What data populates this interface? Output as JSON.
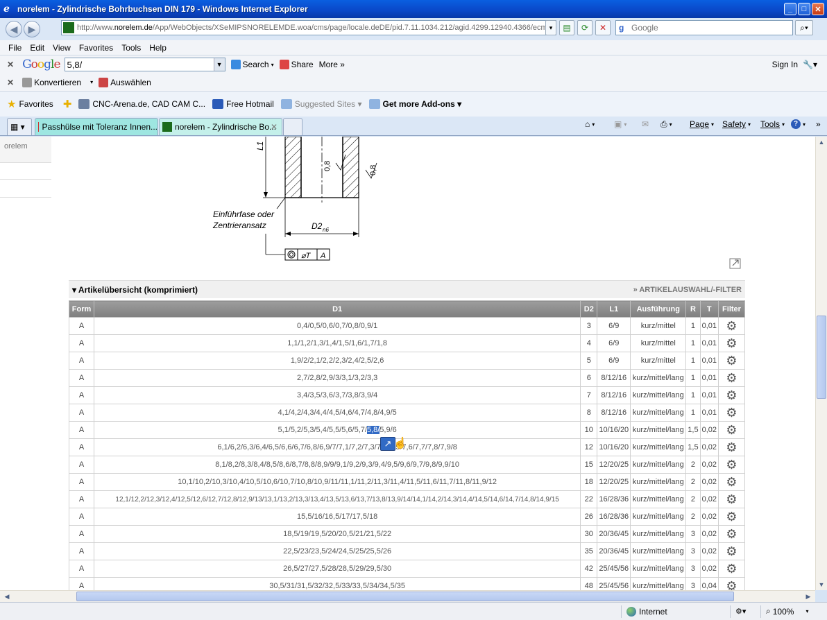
{
  "window": {
    "title": "norelem - Zylindrische Bohrbuchsen DIN 179 - Windows Internet Explorer"
  },
  "address": {
    "prefix": "http://www.",
    "domain": "norelem.de",
    "path": "/App/WebObjects/XSeMIPSNORELEMDE.woa/cms/page/locale.deDE/pid.7.11.1034.212/agid.4299.12940.4366/ecm"
  },
  "search_box": {
    "placeholder": "Google"
  },
  "menu": [
    "File",
    "Edit",
    "View",
    "Favorites",
    "Tools",
    "Help"
  ],
  "google_toolbar": {
    "logo": "Google",
    "query": "5,8/",
    "search": "Search",
    "share": "Share",
    "more": "More »",
    "sign_in": "Sign In"
  },
  "konvert_bar": {
    "konvertieren": "Konvertieren",
    "auswaehlen": "Auswählen"
  },
  "favorites_bar": {
    "favorites": "Favorites",
    "items": [
      "CNC-Arena.de, CAD CAM C...",
      "Free Hotmail",
      "Suggested Sites ▾",
      "Get more Add-ons ▾"
    ]
  },
  "tabs": [
    {
      "label": "Passhülse mit Toleranz Innen..."
    },
    {
      "label": "norelem - Zylindrische Bo..."
    }
  ],
  "commands": {
    "page": "Page",
    "safety": "Safety",
    "tools": "Tools"
  },
  "left_nav": {
    "item1": "orelem"
  },
  "drawing": {
    "l1": "L1",
    "dim1": "0,8",
    "dim2": "0,8",
    "note1": "Einführfase oder",
    "note2": "Zentrieransatz",
    "d2": "D2",
    "d2sub": "n6",
    "tol_sym": "⌀T",
    "tol_ref": "A"
  },
  "section": {
    "title": "▾ Artikelübersicht (komprimiert)",
    "filter_link": "» ARTIKELAUSWAHL/-FILTER"
  },
  "table": {
    "headers": [
      "Form",
      "D1",
      "D2",
      "L1",
      "Ausführung",
      "R",
      "T",
      "Filter"
    ],
    "rows": [
      [
        "A",
        "0,4/0,5/0,6/0,7/0,8/0,9/1",
        "3",
        "6/9",
        "kurz/mittel",
        "1",
        "0,01"
      ],
      [
        "A",
        "1,1/1,2/1,3/1,4/1,5/1,6/1,7/1,8",
        "4",
        "6/9",
        "kurz/mittel",
        "1",
        "0,01"
      ],
      [
        "A",
        "1,9/2/2,1/2,2/2,3/2,4/2,5/2,6",
        "5",
        "6/9",
        "kurz/mittel",
        "1",
        "0,01"
      ],
      [
        "A",
        "2,7/2,8/2,9/3/3,1/3,2/3,3",
        "6",
        "8/12/16",
        "kurz/mittel/lang",
        "1",
        "0,01"
      ],
      [
        "A",
        "3,4/3,5/3,6/3,7/3,8/3,9/4",
        "7",
        "8/12/16",
        "kurz/mittel/lang",
        "1",
        "0,01"
      ],
      [
        "A",
        "4,1/4,2/4,3/4,4/4,5/4,6/4,7/4,8/4,9/5",
        "8",
        "8/12/16",
        "kurz/mittel/lang",
        "1",
        "0,01"
      ],
      [
        "A",
        "5,1/5,2/5,3/5,4/5,5/5,6/5,7/5,8/5,9/6",
        "10",
        "10/16/20",
        "kurz/mittel/lang",
        "1,5",
        "0,02"
      ],
      [
        "A",
        "6,1/6,2/6,3/6,4/6,5/6,6/6,7/6,8/6,9/7/7,1/7,2/7,3/7,4/7,5/7,6/7,7/7,8/7,9/8",
        "12",
        "10/16/20",
        "kurz/mittel/lang",
        "1,5",
        "0,02"
      ],
      [
        "A",
        "8,1/8,2/8,3/8,4/8,5/8,6/8,7/8,8/8,9/9/9,1/9,2/9,3/9,4/9,5/9,6/9,7/9,8/9,9/10",
        "15",
        "12/20/25",
        "kurz/mittel/lang",
        "2",
        "0,02"
      ],
      [
        "A",
        "10,1/10,2/10,3/10,4/10,5/10,6/10,7/10,8/10,9/11/11,1/11,2/11,3/11,4/11,5/11,6/11,7/11,8/11,9/12",
        "18",
        "12/20/25",
        "kurz/mittel/lang",
        "2",
        "0,02"
      ],
      [
        "A",
        "12,1/12,2/12,3/12,4/12,5/12,6/12,7/12,8/12,9/13/13,1/13,2/13,3/13,4/13,5/13,6/13,7/13,8/13,9/14/14,1/14,2/14,3/14,4/14,5/14,6/14,7/14,8/14,9/15",
        "22",
        "16/28/36",
        "kurz/mittel/lang",
        "2",
        "0,02"
      ],
      [
        "A",
        "15,5/16/16,5/17/17,5/18",
        "26",
        "16/28/36",
        "kurz/mittel/lang",
        "2",
        "0,02"
      ],
      [
        "A",
        "18,5/19/19,5/20/20,5/21/21,5/22",
        "30",
        "20/36/45",
        "kurz/mittel/lang",
        "3",
        "0,02"
      ],
      [
        "A",
        "22,5/23/23,5/24/24,5/25/25,5/26",
        "35",
        "20/36/45",
        "kurz/mittel/lang",
        "3",
        "0,02"
      ],
      [
        "A",
        "26,5/27/27,5/28/28,5/29/29,5/30",
        "42",
        "25/45/56",
        "kurz/mittel/lang",
        "3",
        "0,02"
      ],
      [
        "A",
        "30,5/31/31,5/32/32,5/33/33,5/34/34,5/35",
        "48",
        "25/45/56",
        "kurz/mittel/lang",
        "3",
        "0,04"
      ]
    ],
    "highlight": {
      "row": 6,
      "pre": "5,1/5,2/5,3/5,4/5,5/5,6/5,7/",
      "sel": "5,8/",
      "post": "5,9/6"
    }
  },
  "statusbar": {
    "zone": "Internet",
    "zoom": "100%"
  }
}
